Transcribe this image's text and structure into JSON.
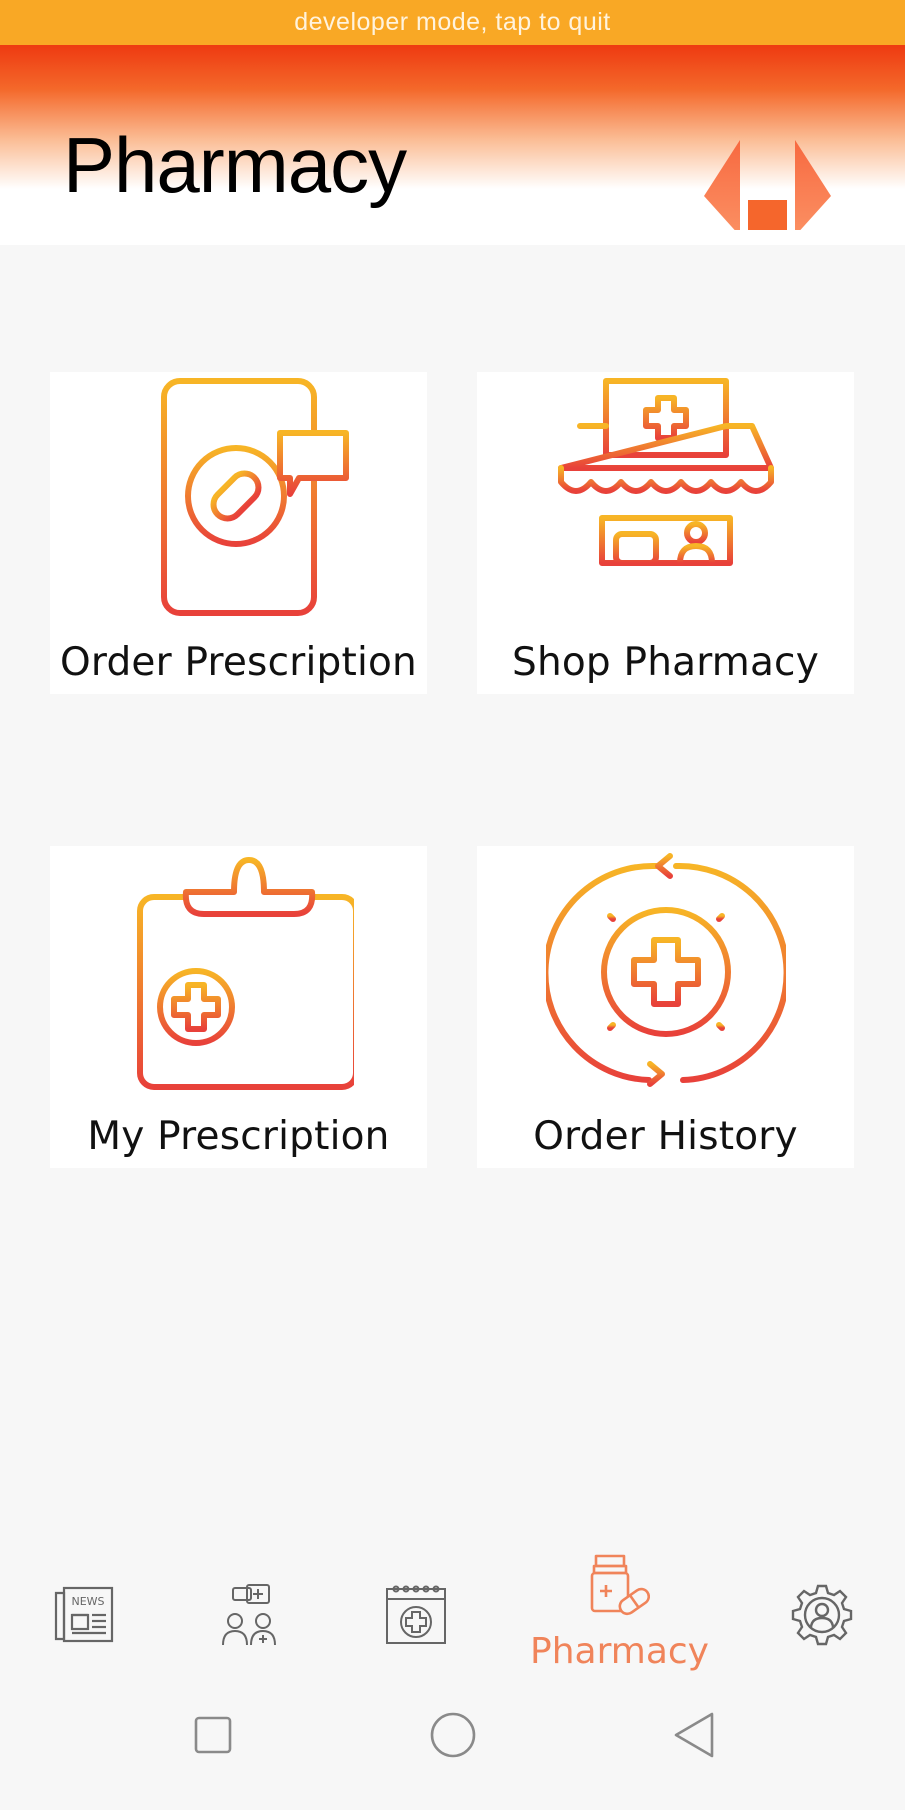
{
  "status_banner": {
    "text": "developer mode, tap to quit"
  },
  "header": {
    "title": "Pharmacy"
  },
  "tiles": [
    {
      "label": "Order Prescription",
      "icon": "phone-pill-chat-icon"
    },
    {
      "label": "Shop Pharmacy",
      "icon": "pharmacy-store-icon"
    },
    {
      "label": "My Prescription",
      "icon": "clipboard-prescription-icon"
    },
    {
      "label": "Order History",
      "icon": "cross-cycle-history-icon"
    }
  ],
  "bottom_nav": {
    "items": [
      {
        "id": "news",
        "icon": "news-icon"
      },
      {
        "id": "doctors",
        "icon": "doctors-chat-icon"
      },
      {
        "id": "appointments",
        "icon": "medical-calendar-icon"
      },
      {
        "id": "pharmacy",
        "icon": "medicine-bottle-icon",
        "label": "Pharmacy",
        "active": true
      },
      {
        "id": "settings",
        "icon": "user-gear-icon"
      }
    ]
  },
  "colors": {
    "banner": "#f9a825",
    "header_top": "#ee3a11",
    "accent": "#f0845a",
    "icon_gradient_top": "#f7b526",
    "icon_gradient_bottom": "#e8413a",
    "nav_icon": "#666666"
  }
}
